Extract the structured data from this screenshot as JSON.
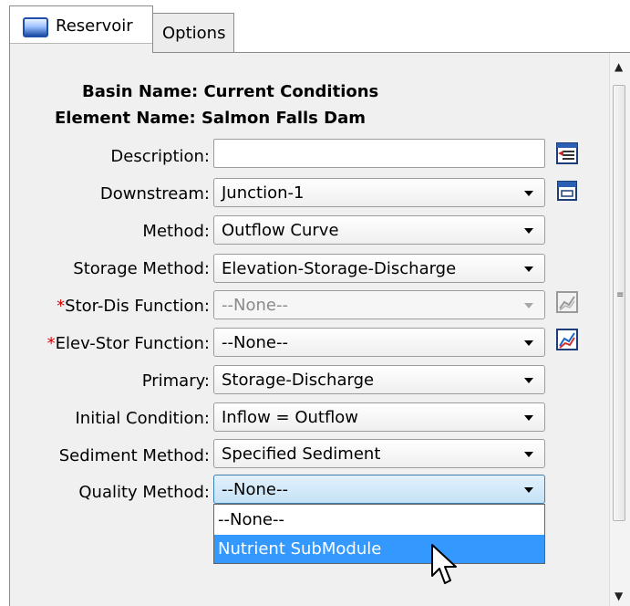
{
  "tabs": [
    {
      "label": "Reservoir",
      "icon": "reservoir-icon"
    },
    {
      "label": "Options"
    }
  ],
  "header": {
    "basin": "Basin Name: Current Conditions",
    "element": "Element Name: Salmon Falls Dam"
  },
  "fields": {
    "description": {
      "label": "Description:",
      "value": ""
    },
    "downstream": {
      "label": "Downstream:",
      "value": "Junction-1"
    },
    "method": {
      "label": "Method:",
      "value": "Outflow Curve"
    },
    "storage_method": {
      "label": "Storage Method:",
      "value": "Elevation-Storage-Discharge"
    },
    "stor_dis": {
      "required_mark": "*",
      "label": "Stor-Dis Function:",
      "value": "--None--"
    },
    "elev_stor": {
      "required_mark": "*",
      "label": "Elev-Stor Function:",
      "value": "--None--"
    },
    "primary": {
      "label": "Primary:",
      "value": "Storage-Discharge"
    },
    "initial_condition": {
      "label": "Initial Condition:",
      "value": "Inflow = Outflow"
    },
    "sediment_method": {
      "label": "Sediment Method:",
      "value": "Specified Sediment"
    },
    "quality_method": {
      "label": "Quality Method:",
      "value": "--None--"
    }
  },
  "dropdown": {
    "options": [
      "--None--",
      "Nutrient SubModule"
    ],
    "highlighted_index": 1
  },
  "colors": {
    "required": "#d40000",
    "highlight": "#3399ff",
    "panel_bg": "#f0f0f0"
  }
}
